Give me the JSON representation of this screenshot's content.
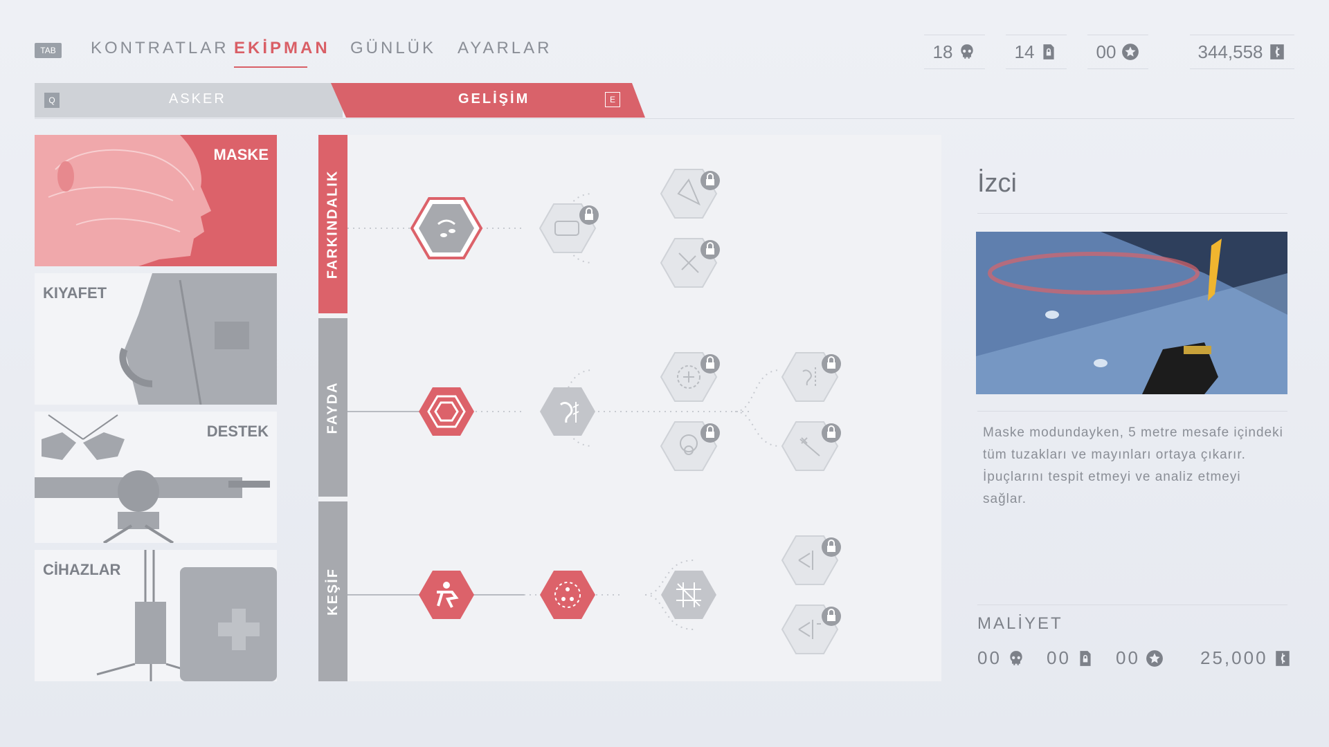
{
  "nav": {
    "tab_key": "TAB",
    "items": [
      "KONTRATLAR",
      "EKİPMAN",
      "GÜNLÜK",
      "AYARLAR"
    ],
    "active": "EKİPMAN"
  },
  "currencies": [
    {
      "value": "18",
      "icon": "skull-icon"
    },
    {
      "value": "14",
      "icon": "lock-doc-icon"
    },
    {
      "value": "00",
      "icon": "star-icon"
    },
    {
      "value": "344,558",
      "icon": "credit-icon"
    }
  ],
  "subtabs": {
    "left_key": "Q",
    "left_label": "ASKER",
    "right_label": "GELİŞİM",
    "right_key": "E",
    "active": "GELİŞİM"
  },
  "equipment": [
    {
      "label": "MASKE",
      "active": true
    },
    {
      "label": "KIYAFET",
      "active": false
    },
    {
      "label": "DESTEK",
      "active": false
    },
    {
      "label": "CİHAZLAR",
      "active": false
    }
  ],
  "categories": [
    "FARKINDALIK",
    "FAYDA",
    "KEŞİF"
  ],
  "detail": {
    "title": "İzci",
    "description": "Maske modundayken, 5 metre mesafe içindeki tüm tuzakları ve mayınları ortaya çıkarır. İpuçlarını tespit etmeyi ve analiz etmeyi sağlar.",
    "cost_label": "MALİYET",
    "costs": [
      {
        "value": "00",
        "icon": "skull-icon"
      },
      {
        "value": "00",
        "icon": "lock-doc-icon"
      },
      {
        "value": "00",
        "icon": "star-icon"
      },
      {
        "value": "25,000",
        "icon": "credit-icon"
      }
    ]
  },
  "colors": {
    "accent": "#d95f66",
    "locked": "#c9ccd2",
    "panel": "#f1f2f5"
  }
}
